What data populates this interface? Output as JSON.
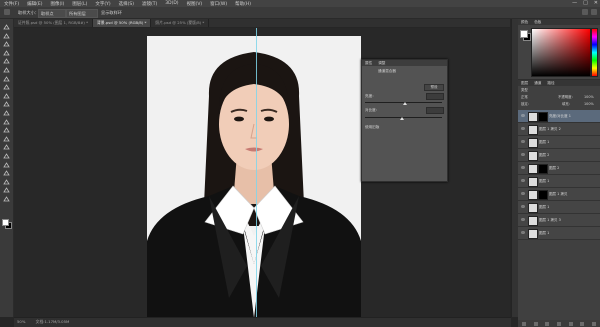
{
  "menubar": {
    "items": [
      "文件(F)",
      "编辑(E)",
      "图像(I)",
      "图层(L)",
      "文字(Y)",
      "选择(S)",
      "滤镜(T)",
      "3D(D)",
      "视图(V)",
      "窗口(W)",
      "帮助(H)"
    ],
    "window_controls": [
      "—",
      "□",
      "✕"
    ]
  },
  "options_bar": {
    "sample_label": "取样大小：",
    "sample_value": "取样点",
    "sample_all": "所有图层",
    "show_ring": "显示取样环"
  },
  "tabs": [
    {
      "label": "证件照.psd @ 50% (图层 1, RGB/8#) *"
    },
    {
      "label": "背景.psd @ 50% (RGB/8) *"
    },
    {
      "label": "照片.psd @ 25% (蒙版/8) *"
    }
  ],
  "properties": {
    "tab_properties": "属性",
    "tab_adjust": "调整",
    "header_label": "通道混合器",
    "preset_button": "预设",
    "brightness_label": "亮度：",
    "contrast_label": "对比度：",
    "legacy_label": "使用旧版"
  },
  "color_panel": {
    "tab_color": "颜色",
    "tab_swatches": "色板",
    "fg_color": "#ffffff",
    "bg_color": "#000000"
  },
  "layers": {
    "tabs": [
      "图层",
      "通道",
      "路径"
    ],
    "kind_label": "类型",
    "blend_mode": "正常",
    "opacity_label": "不透明度：",
    "opacity_value": "100%",
    "lock_label": "锁定：",
    "fill_label": "填充：",
    "fill_value": "100%",
    "rows": [
      {
        "name": "亮度/对比度 1",
        "selected": true,
        "has_mask": true
      },
      {
        "name": "图层 1 拷贝 2",
        "selected": false,
        "has_mask": false
      },
      {
        "name": "图层 1",
        "selected": false,
        "has_mask": false
      },
      {
        "name": "图层 2",
        "selected": false,
        "has_mask": false
      },
      {
        "name": "图层 2",
        "selected": false,
        "has_mask": true
      },
      {
        "name": "图层 1",
        "selected": false,
        "has_mask": false
      },
      {
        "name": "图层 1 拷贝",
        "selected": false,
        "has_mask": true
      },
      {
        "name": "图层 1",
        "selected": false,
        "has_mask": false
      },
      {
        "name": "图层 1 拷贝 3",
        "selected": false,
        "has_mask": false
      },
      {
        "name": "图层 1",
        "selected": false,
        "has_mask": false
      }
    ]
  },
  "status": {
    "zoom": "50%",
    "doc": "文档:1.17M/3.05M"
  }
}
